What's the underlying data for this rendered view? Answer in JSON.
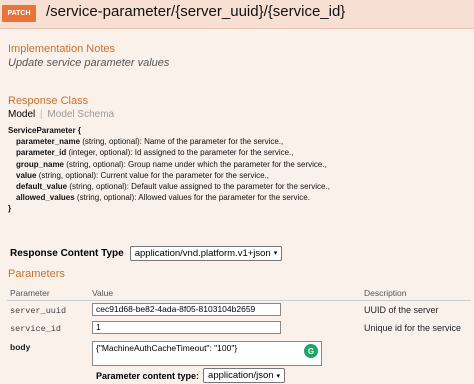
{
  "header": {
    "method": "PATCH",
    "path": "/service-parameter/{server_uuid}/{service_id}"
  },
  "implementation_notes": {
    "title": "Implementation Notes",
    "text": "Update service parameter values"
  },
  "response_class": {
    "title": "Response Class",
    "tab_model": "Model",
    "tab_schema": "Model Schema",
    "model_name": "ServiceParameter {",
    "model_close": "}",
    "fields": [
      {
        "name": "parameter_name",
        "desc": " (string, optional): Name of the parameter for the service.,"
      },
      {
        "name": "parameter_id",
        "desc": " (integer, optional): Id assigned to the parameter for the service.,"
      },
      {
        "name": "group_name",
        "desc": " (string, optional): Group name under which the parameter for the service.,"
      },
      {
        "name": "value",
        "desc": " (string, optional): Current value for the parameter for the service.,"
      },
      {
        "name": "default_value",
        "desc": " (string, optional): Default value assigned to the parameter for the service.,"
      },
      {
        "name": "allowed_values",
        "desc": " (string, optional): Allowed values for the parameter for the service."
      }
    ]
  },
  "response_content_type": {
    "label": "Response Content Type",
    "value": "application/vnd.platform.v1+json"
  },
  "parameters": {
    "title": "Parameters",
    "columns": {
      "parameter": "Parameter",
      "value": "Value",
      "description": "Description"
    },
    "rows": [
      {
        "name": "server_uuid",
        "value": "cec91d68-be82-4ada-8f05-8103104b2659",
        "description": "UUID of the server"
      },
      {
        "name": "service_id",
        "value": "1",
        "description": "Unique id for the service"
      },
      {
        "name": "body",
        "value": "{\"MachineAuthCacheTimeout\": \"100\"}",
        "description": ""
      }
    ],
    "content_type_label": "Parameter content type:",
    "content_type_value": "application/json"
  },
  "colors": {
    "accent": "#c4722f",
    "method_badge": "#e8743a",
    "header_bg": "#f7e0d3",
    "page_bg": "#fbf1eb"
  }
}
